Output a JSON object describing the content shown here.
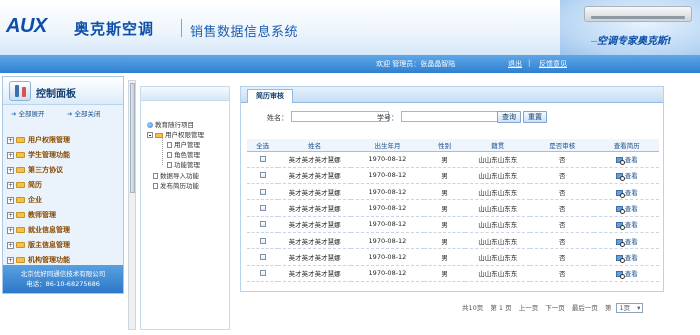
{
  "header": {
    "brand": "AUX",
    "brand_cn": "奥克斯空调",
    "system_title": "销售数据信息系统",
    "promo_slogan": "空调专家奥克斯!",
    "promo_small": "一"
  },
  "statusbar": {
    "user_text": "欢迎 管理员：张晶晶智陆",
    "logout": "退出",
    "separator": "|",
    "feedback": "反馈意见"
  },
  "leftpanel": {
    "title": "控制面板",
    "expand_all": "全部展开",
    "collapse_all": "全部关闭",
    "menu": [
      "用户权限管理",
      "学生管理功能",
      "第三方协议",
      "简历",
      "企业",
      "教师管理",
      "就业信息管理",
      "版主信息管理",
      "机构管理功能"
    ],
    "company_name": "北京优好同通信技术有限公司",
    "company_phone": "电话：86-10-68275686"
  },
  "tree": {
    "root": "教育随行项目",
    "group": "用户权限管理",
    "children": [
      "用户管理",
      "角色管理",
      "功能管理"
    ],
    "extra": [
      "数据导入功能",
      "发布简历功能"
    ]
  },
  "main": {
    "tab": "简历审核",
    "search": {
      "name_label": "姓名：",
      "name_value": "",
      "id_label": "学号：",
      "id_value": "",
      "query_button": "查询",
      "reset_button": "重置"
    },
    "columns": [
      "全选",
      "姓名",
      "出生年月",
      "性别",
      "籍贯",
      "是否审核",
      "查看简历"
    ],
    "rows": [
      {
        "name": "英才英才英才慧娜",
        "birth": "1970-08-12",
        "gender": "男",
        "origin": "山山东山东东",
        "reviewed": "否",
        "action": "查看"
      },
      {
        "name": "英才英才英才慧娜",
        "birth": "1970-08-12",
        "gender": "男",
        "origin": "山山东山东东",
        "reviewed": "否",
        "action": "查看"
      },
      {
        "name": "英才英才英才慧娜",
        "birth": "1970-08-12",
        "gender": "男",
        "origin": "山山东山东东",
        "reviewed": "否",
        "action": "查看"
      },
      {
        "name": "英才英才英才慧娜",
        "birth": "1970-08-12",
        "gender": "男",
        "origin": "山山东山东东",
        "reviewed": "否",
        "action": "查看"
      },
      {
        "name": "英才英才英才慧娜",
        "birth": "1970-08-12",
        "gender": "男",
        "origin": "山山东山东东",
        "reviewed": "否",
        "action": "查看"
      },
      {
        "name": "英才英才英才慧娜",
        "birth": "1970-08-12",
        "gender": "男",
        "origin": "山山东山东东",
        "reviewed": "否",
        "action": "查看"
      },
      {
        "name": "英才英才英才慧娜",
        "birth": "1970-08-12",
        "gender": "男",
        "origin": "山山东山东东",
        "reviewed": "否",
        "action": "查看"
      },
      {
        "name": "英才英才英才慧娜",
        "birth": "1970-08-12",
        "gender": "男",
        "origin": "山山东山东东",
        "reviewed": "否",
        "action": "查看"
      }
    ]
  },
  "pager": {
    "total": "共10页",
    "current": "第 1 页",
    "prev": "上一页",
    "next": "下一页",
    "last": "最后一页",
    "goto_label": "第",
    "goto_value": "1页"
  },
  "colors": {
    "brand_blue": "#0d4fa8",
    "statusbar": "#2f80d1",
    "menu_text": "#8a4a00"
  }
}
